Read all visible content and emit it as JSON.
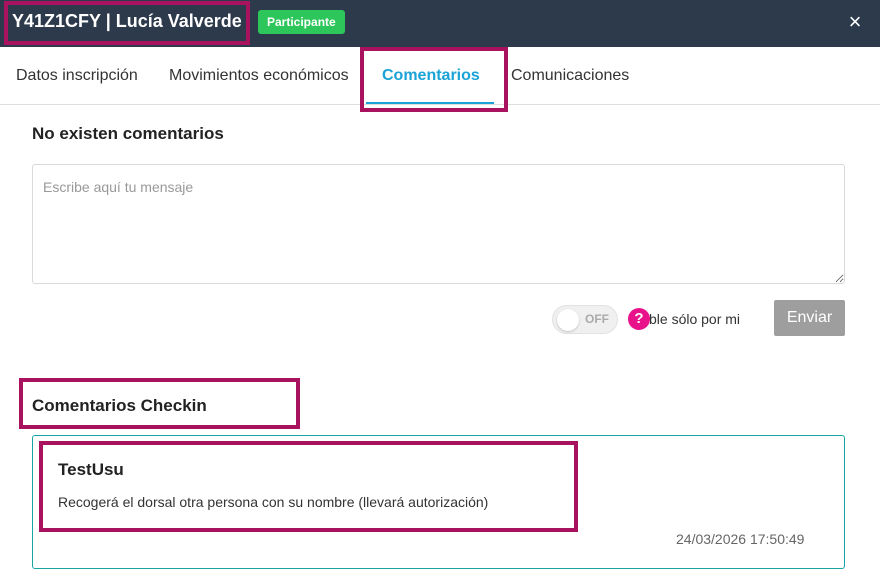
{
  "header": {
    "title": "Y41Z1CFY | Lucía Valverde",
    "badge": "Participante",
    "close_icon": "×",
    "bg_color": "#2c3a4b",
    "badge_color": "#2dc65a"
  },
  "tabs": [
    {
      "label": "Datos inscripción",
      "active": false
    },
    {
      "label": "Movimientos económicos",
      "active": false
    },
    {
      "label": "Comentarios",
      "active": true
    },
    {
      "label": "Comunicaciones",
      "active": false
    }
  ],
  "comments": {
    "empty_title": "No existen comentarios",
    "placeholder": "Escribe aquí tu mensaje",
    "toggle_label": "OFF",
    "toggle_on": false,
    "help_icon": "?",
    "visibility_label": "ble sólo por mi",
    "send_label": "Enviar"
  },
  "checkin": {
    "title": "Comentarios Checkin",
    "items": [
      {
        "author": "TestUsu",
        "text": "Recogerá el dorsal otra persona con su nombre (llevará autorización)",
        "date": "24/03/2026 17:50:49"
      }
    ]
  },
  "colors": {
    "accent": "#1aa3d6",
    "highlight": "#a8125f",
    "card_border": "#16a5a5",
    "help": "#e8128a"
  }
}
